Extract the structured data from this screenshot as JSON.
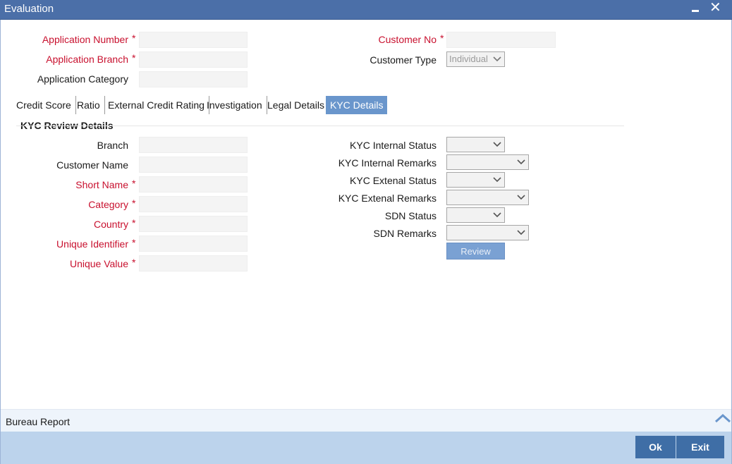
{
  "window": {
    "title": "Evaluation"
  },
  "header": {
    "application_number_label": "Application Number",
    "application_branch_label": "Application Branch",
    "application_category_label": "Application Category",
    "customer_no_label": "Customer No",
    "customer_type_label": "Customer Type",
    "customer_type_value": "Individual",
    "required_mark": "*"
  },
  "tabs": [
    {
      "label": "Credit Score"
    },
    {
      "label": "Ratio"
    },
    {
      "label": "External Credit Rating"
    },
    {
      "label": "Investigation"
    },
    {
      "label": "Legal Details"
    },
    {
      "label": "KYC Details",
      "active": true
    }
  ],
  "kyc": {
    "section_title": "KYC Review Details",
    "left_labels": {
      "branch": "Branch",
      "customer_name": "Customer Name",
      "short_name": "Short Name",
      "category": "Category",
      "country": "Country",
      "unique_identifier": "Unique Identifier",
      "unique_value": "Unique Value"
    },
    "right_labels": {
      "internal_status": "KYC Internal Status",
      "internal_remarks": "KYC Internal Remarks",
      "external_status": "KYC Extenal Status",
      "external_remarks": "KYC Extenal Remarks",
      "sdn_status": "SDN Status",
      "sdn_remarks": "SDN Remarks"
    },
    "review_button": "Review"
  },
  "bureau": {
    "label": "Bureau Report"
  },
  "footer": {
    "ok_label": "Ok",
    "exit_label": "Exit"
  },
  "colors": {
    "titlebar": "#4b6fa8",
    "required": "#c8102e",
    "active_tab": "#6a96cc",
    "footer": "#bcd3ec",
    "button": "#3f6ea6"
  },
  "icons": [
    "minimize-icon",
    "close-icon",
    "chevron-down-icon",
    "chevron-up-icon"
  ]
}
